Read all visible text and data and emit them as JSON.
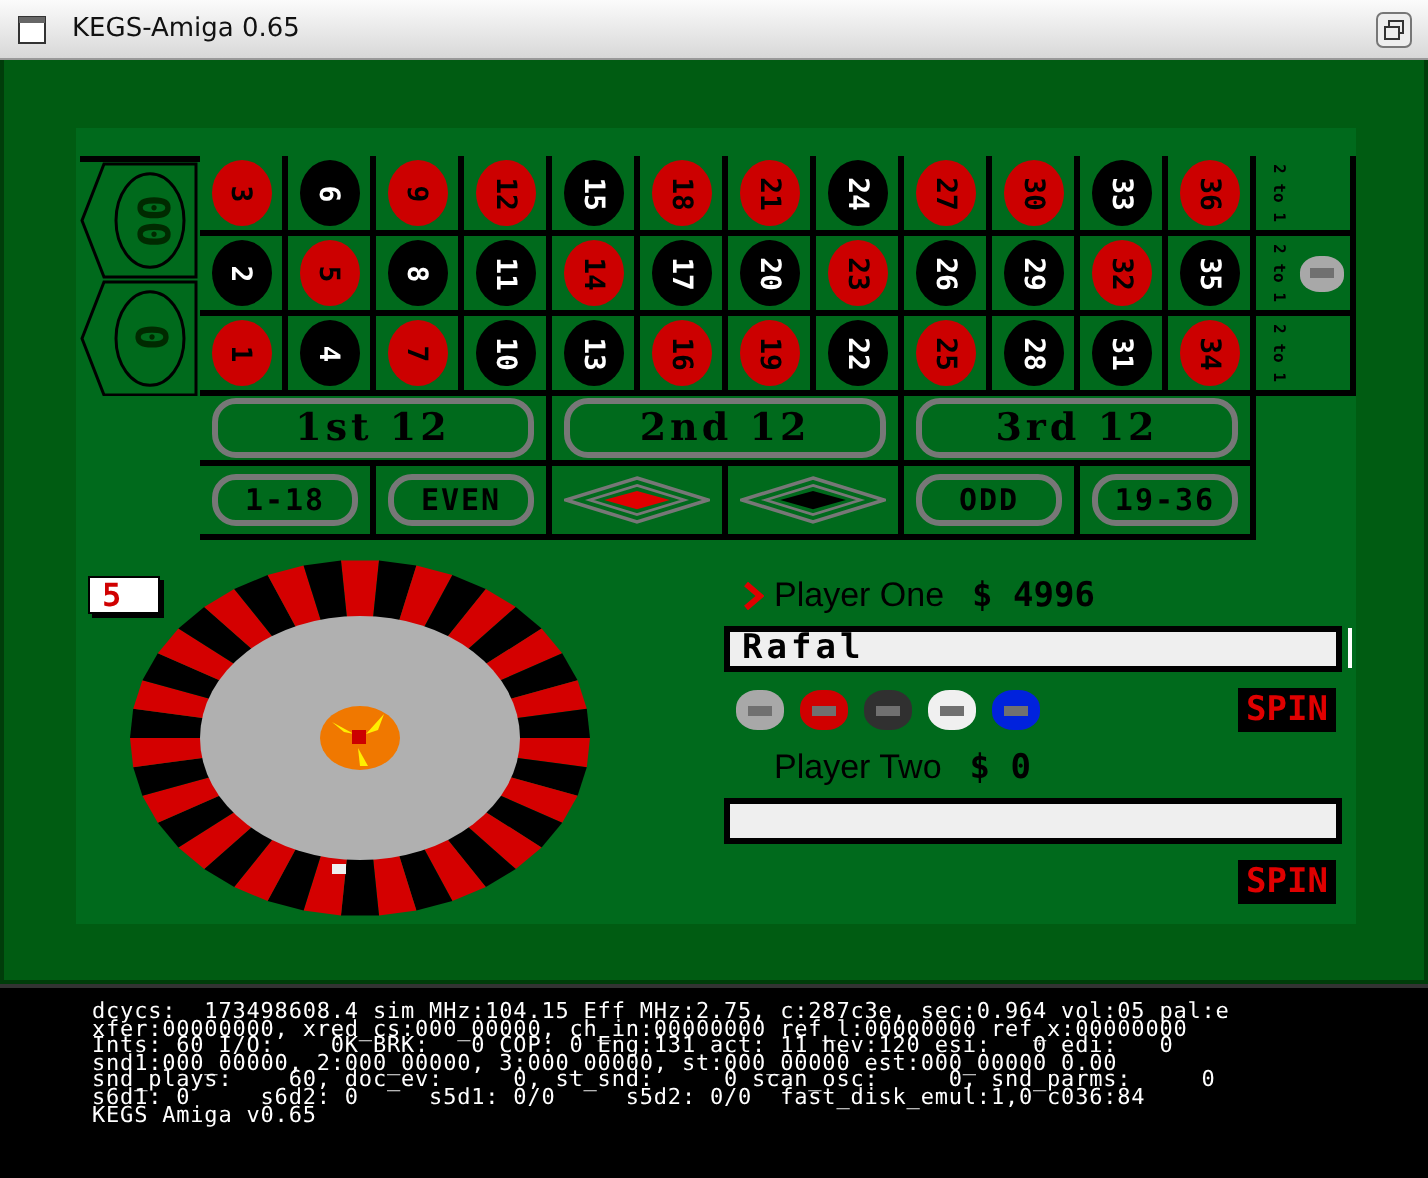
{
  "window": {
    "title": "KEGS-Amiga 0.65"
  },
  "table": {
    "zeros": [
      {
        "label": "00"
      },
      {
        "label": "0"
      }
    ],
    "numbers": [
      {
        "label": "3",
        "color": "#cc0000"
      },
      {
        "label": "6",
        "color": "#000000"
      },
      {
        "label": "9",
        "color": "#cc0000"
      },
      {
        "label": "12",
        "color": "#cc0000"
      },
      {
        "label": "15",
        "color": "#000000"
      },
      {
        "label": "18",
        "color": "#cc0000"
      },
      {
        "label": "21",
        "color": "#cc0000"
      },
      {
        "label": "24",
        "color": "#000000"
      },
      {
        "label": "27",
        "color": "#cc0000"
      },
      {
        "label": "30",
        "color": "#cc0000"
      },
      {
        "label": "33",
        "color": "#000000"
      },
      {
        "label": "36",
        "color": "#cc0000"
      },
      {
        "label": "2",
        "color": "#000000"
      },
      {
        "label": "5",
        "color": "#cc0000"
      },
      {
        "label": "8",
        "color": "#000000"
      },
      {
        "label": "11",
        "color": "#000000"
      },
      {
        "label": "14",
        "color": "#cc0000"
      },
      {
        "label": "17",
        "color": "#000000"
      },
      {
        "label": "20",
        "color": "#000000"
      },
      {
        "label": "23",
        "color": "#cc0000"
      },
      {
        "label": "26",
        "color": "#000000"
      },
      {
        "label": "29",
        "color": "#000000"
      },
      {
        "label": "32",
        "color": "#cc0000"
      },
      {
        "label": "35",
        "color": "#000000"
      },
      {
        "label": "1",
        "color": "#cc0000"
      },
      {
        "label": "4",
        "color": "#000000"
      },
      {
        "label": "7",
        "color": "#cc0000"
      },
      {
        "label": "10",
        "color": "#000000"
      },
      {
        "label": "13",
        "color": "#000000"
      },
      {
        "label": "16",
        "color": "#cc0000"
      },
      {
        "label": "19",
        "color": "#cc0000"
      },
      {
        "label": "22",
        "color": "#000000"
      },
      {
        "label": "25",
        "color": "#cc0000"
      },
      {
        "label": "28",
        "color": "#000000"
      },
      {
        "label": "31",
        "color": "#000000"
      },
      {
        "label": "34",
        "color": "#cc0000"
      }
    ],
    "column_bets": [
      {
        "label": "2 to 1"
      },
      {
        "label": "2 to 1",
        "chip": true
      },
      {
        "label": "2 to 1"
      }
    ],
    "dozens": [
      {
        "label": "1st 12"
      },
      {
        "label": "2nd 12"
      },
      {
        "label": "3rd 12"
      }
    ],
    "outside_bets": [
      {
        "kind": "text",
        "label": "1-18"
      },
      {
        "kind": "text",
        "label": "EVEN"
      },
      {
        "kind": "diamond",
        "color": "#e00000"
      },
      {
        "kind": "diamond",
        "color": "#000000"
      },
      {
        "kind": "text",
        "label": "ODD"
      },
      {
        "kind": "text",
        "label": "19-36"
      }
    ]
  },
  "result": "5",
  "players": [
    {
      "name": "Player One",
      "money": "$ 4996",
      "active": true,
      "value": "Rafal",
      "chips": [
        {
          "color": "#a8a8a8"
        },
        {
          "color": "#d00000"
        },
        {
          "color": "#303030"
        },
        {
          "color": "#f0f0f0"
        },
        {
          "color": "#0022dd"
        }
      ],
      "spin": "SPIN"
    },
    {
      "name": "Player Two",
      "money": "$ 0",
      "active": false,
      "spin": "SPIN"
    }
  ],
  "console": [
    "dcycs:  173498608.4 sim MHz:104.15 Eff MHz:2.75, c:287c3e, sec:0.964 vol:05 pal:e",
    "xfer:00000000, xred_cs:000_00000, ch_in:00000000 ref_l:00000000 ref_x:00000000",
    "Ints: 60 I/O:    0K BRK:   0 COP: 0 Eng:131 act: 11 hev:120 esi:   0 edi:   0",
    "snd1:000_00000, 2:000_00000, 3:000_00000, st:000_00000 est:000_00000 0.00",
    "snd_plays:    60, doc_ev:     0, st_snd:     0 scan_osc:     0, snd_parms:     0",
    "s6d1: 0     s6d2: 0     s5d1: 0/0     s5d2: 0/0  fast_disk_emul:1,0 c036:84",
    "KEGS Amiga v0.65"
  ]
}
